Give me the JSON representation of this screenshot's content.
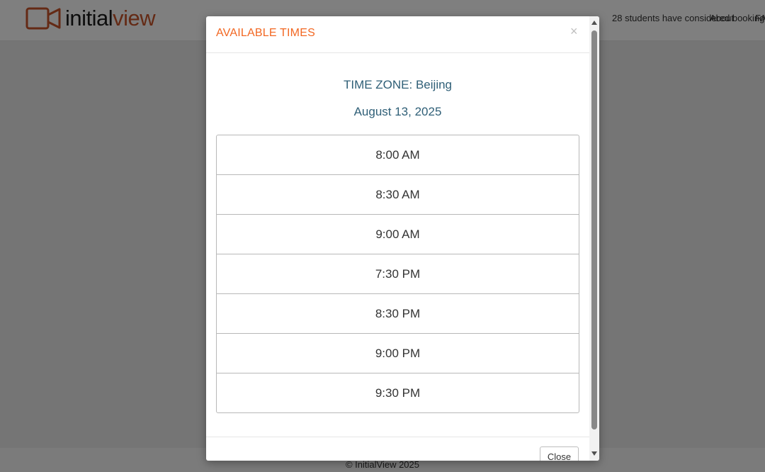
{
  "header": {
    "logo": {
      "word1": "initial",
      "word2": "view",
      "brand_color": "#c8552a",
      "icon": "video-camera-icon"
    },
    "nav": {
      "students_text": "28 students have considered booking",
      "about_label": "About",
      "faq_label": "FAQ"
    }
  },
  "footer": {
    "copyright": "© InitialView 2025"
  },
  "modal": {
    "title": "AVAILABLE TIMES",
    "close_icon": "×",
    "time_zone": "TIME ZONE: Beijing",
    "date": "August 13, 2025",
    "slots": [
      "8:00 AM",
      "8:30 AM",
      "9:00 AM",
      "7:30 PM",
      "8:30 PM",
      "9:00 PM",
      "9:30 PM"
    ],
    "close_button_label": "Close"
  },
  "colors": {
    "title_accent": "#f26722",
    "info_text": "#2f5f77",
    "backdrop": "rgba(0,0,0,0.5)"
  }
}
